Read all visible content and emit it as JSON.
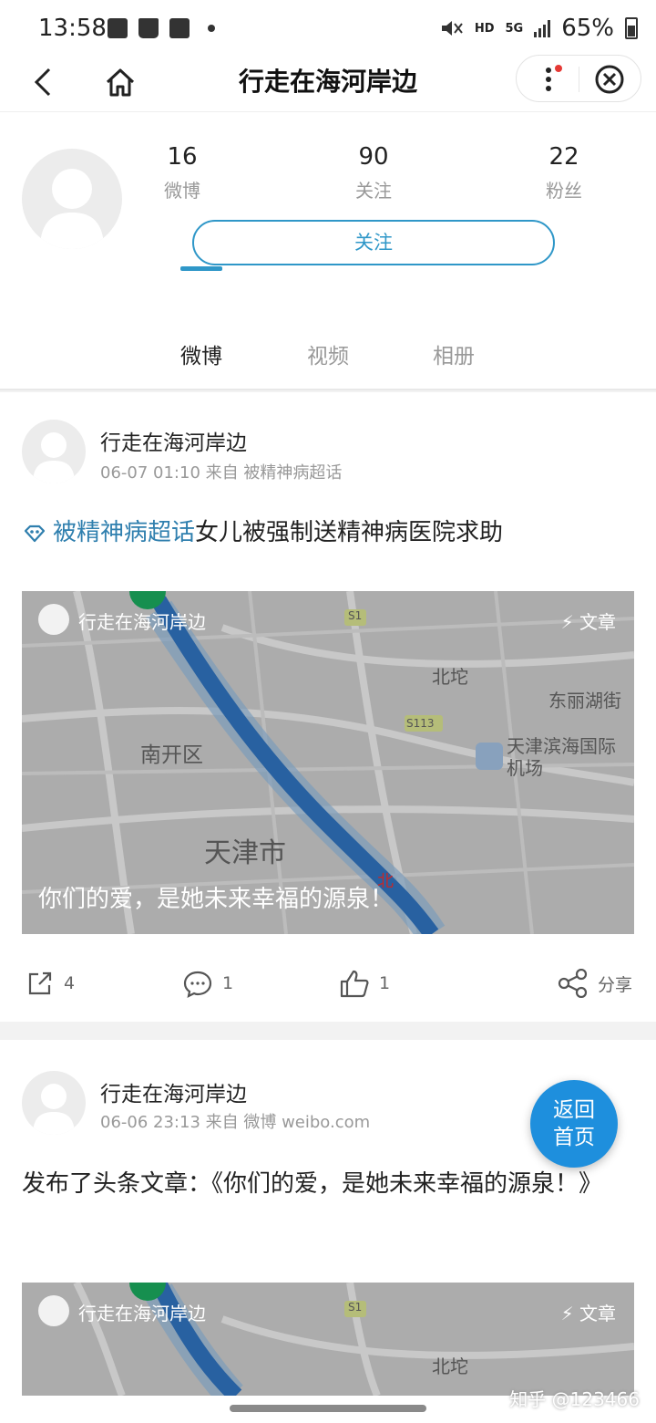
{
  "status": {
    "time": "13:58",
    "network": "5G",
    "hd": "HD",
    "battery": "65%"
  },
  "nav": {
    "title": "行走在海河岸边"
  },
  "profile": {
    "stats": [
      {
        "num": "16",
        "label": "微博"
      },
      {
        "num": "90",
        "label": "关注"
      },
      {
        "num": "22",
        "label": "粉丝"
      }
    ],
    "follow_label": "关注"
  },
  "tabs": [
    "微博",
    "视频",
    "相册"
  ],
  "posts": [
    {
      "author": "行走在海河岸边",
      "meta": "06-07 01:10 来自 被精神病超话",
      "topic": "被精神病超话",
      "text": "女儿被强制送精神病医院求助",
      "card": {
        "name": "行走在海河岸边",
        "tag": "文章",
        "caption": "你们的爱，是她未来幸福的源泉！"
      },
      "actions": {
        "repost": "4",
        "comment": "1",
        "like": "1",
        "share": "分享"
      }
    },
    {
      "author": "行走在海河岸边",
      "meta": "06-06 23:13 来自 微博 weibo.com",
      "text": "发布了头条文章：《你们的爱，是她未来幸福的源泉！》",
      "card": {
        "name": "行走在海河岸边",
        "tag": "文章"
      }
    }
  ],
  "map_labels": [
    "北坨",
    "东丽湖街",
    "天津滨海国际机场",
    "南开区",
    "天津市",
    "S1",
    "S113",
    "北"
  ],
  "back_home_line1": "返回",
  "back_home_line2": "首页",
  "watermark": "知乎 @123466"
}
